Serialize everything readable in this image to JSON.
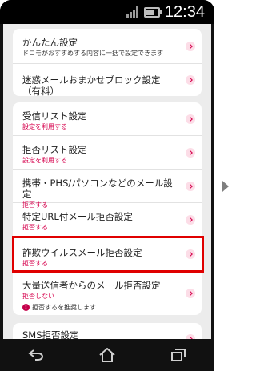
{
  "status_bar": {
    "time": "12:34"
  },
  "settings": {
    "group1": [
      {
        "title": "かんたん設定",
        "sub": "ドコモがおすすめする内容に一括で設定できます"
      },
      {
        "title": "迷惑メールおまかせブロック設定（有料）"
      }
    ],
    "group2": [
      {
        "title": "受信リスト設定",
        "sub": "設定を利用する"
      },
      {
        "title": "拒否リスト設定",
        "sub": "設定を利用する"
      },
      {
        "title": "携帯・PHS/パソコンなどのメール設定",
        "sub": "拒否する"
      },
      {
        "title": "特定URL付メール拒否設定",
        "sub": "拒否する"
      },
      {
        "title": "詐欺ウイルスメール拒否設定",
        "sub": "拒否する"
      },
      {
        "title": "大量送信者からのメール拒否設定",
        "sub": "拒否しない",
        "note": "拒否するを推奨します"
      }
    ],
    "group3": [
      {
        "title": "SMS拒否設定"
      }
    ]
  },
  "colors": {
    "accent": "#d6004c",
    "highlight_border": "#e00000",
    "screen_background": "#ececec"
  },
  "icons": {
    "nav_back": "back-arrow-icon",
    "nav_home": "home-icon",
    "nav_recent": "recent-apps-icon",
    "next": "play-triangle-icon"
  }
}
